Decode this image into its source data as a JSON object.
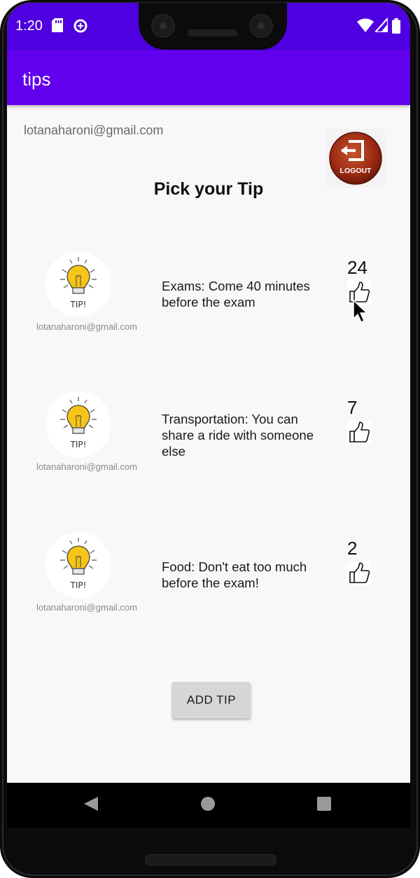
{
  "status_bar": {
    "time": "1:20"
  },
  "app_bar": {
    "title": "tips"
  },
  "user": {
    "email": "lotanaharoni@gmail.com"
  },
  "logout": {
    "label": "LOGOUT"
  },
  "heading": "Pick your Tip",
  "tips": [
    {
      "author": "lotanaharoni@gmail.com",
      "text": "Exams:  Come 40 minutes before the exam",
      "likes": "24",
      "image_label": "TIP!"
    },
    {
      "author": "lotanaharoni@gmail.com",
      "text": "Transportation:  You can share a ride with someone else",
      "likes": "7",
      "image_label": "TIP!"
    },
    {
      "author": "lotanaharoni@gmail.com",
      "text": "Food:  Don't eat too much before the exam!",
      "likes": "2",
      "image_label": "TIP!"
    }
  ],
  "actions": {
    "add_tip": "ADD TIP"
  },
  "icons": {
    "status": [
      "sd-card-icon",
      "data-saver-icon",
      "wifi-icon",
      "signal-icon",
      "battery-icon"
    ],
    "tip": "lightbulb-icon",
    "like": "thumbs-up-icon",
    "nav": [
      "back-icon",
      "home-icon",
      "recents-icon"
    ]
  },
  "colors": {
    "status_bar": "#4f00e0",
    "app_bar": "#6200ee",
    "background": "#f8f7fa",
    "bulb": "#f5c518",
    "logout": "#a8341c"
  }
}
